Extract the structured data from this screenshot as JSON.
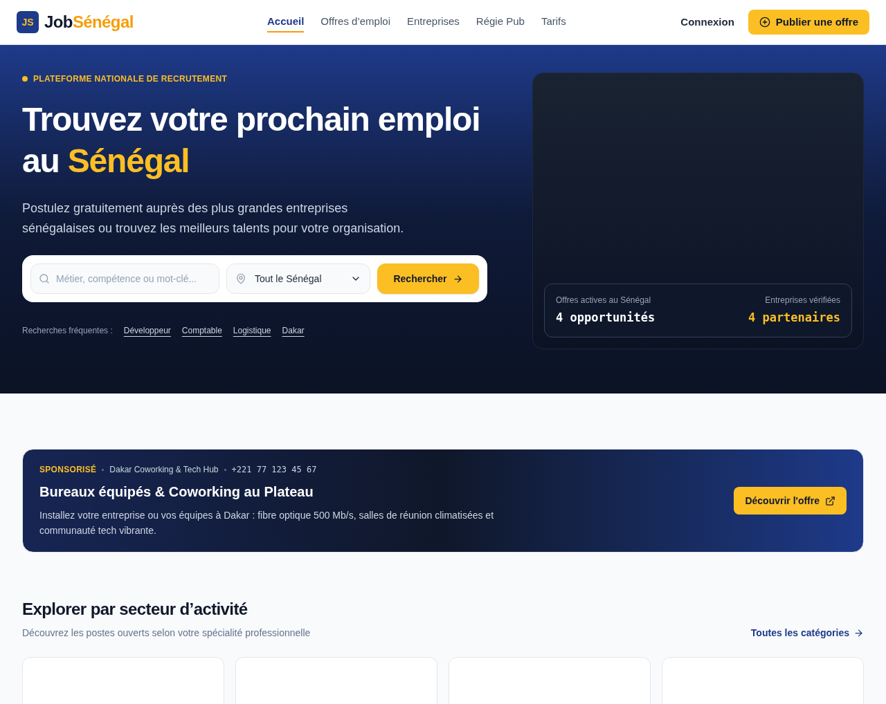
{
  "header": {
    "logo_mark": "JS",
    "logo_first": "Job",
    "logo_second": "Sénégal",
    "nav": [
      {
        "label": "Accueil",
        "selected": true
      },
      {
        "label": "Offres d’emploi",
        "selected": false
      },
      {
        "label": "Entreprises",
        "selected": false
      },
      {
        "label": "Régie Pub",
        "selected": false
      },
      {
        "label": "Tarifs",
        "selected": false
      }
    ],
    "login": "Connexion",
    "publish": "Publier une offre"
  },
  "hero": {
    "eyebrow": "PLATEFORME NATIONALE DE RECRUTEMENT",
    "title": "Trouvez votre prochain emploi au",
    "title_highlight": "Sénégal",
    "subtitle": "Postulez gratuitement auprès des plus grandes entreprises sénégalaises ou trouvez les meilleurs talents pour votre organisation.",
    "search": {
      "placeholder": "Métier, compétence ou mot-clé...",
      "location": "Tout le Sénégal",
      "button": "Rechercher"
    },
    "frequent_label": "Recherches fréquentes :",
    "frequent": [
      "Développeur",
      "Comptable",
      "Logistique",
      "Dakar"
    ],
    "stats": [
      {
        "label": "Offres actives au Sénégal",
        "value": "4 opportunités"
      },
      {
        "label": "Entreprises vérifiées",
        "value": "4 partenaires"
      }
    ]
  },
  "sponsored": {
    "tag": "SPONSORISÉ",
    "company": "Dakar Coworking & Tech Hub",
    "phone": "+221 77 123 45 67",
    "title": "Bureaux équipés & Coworking au Plateau",
    "text": "Installez votre entreprise ou vos équipes à Dakar : fibre optique 500 Mb/s, salles de réunion climatisées et communauté tech vibrante.",
    "button": "Découvrir l'offre"
  },
  "sectors": {
    "title": "Explorer par secteur d’activité",
    "subtitle": "Découvrez les postes ouverts selon votre spécialité professionnelle",
    "link": "Toutes les catégories",
    "cards": [
      {
        "kind": "blank"
      },
      {
        "kind": "blank"
      },
      {
        "kind": "blank"
      },
      {
        "kind": "blank"
      }
    ]
  }
}
